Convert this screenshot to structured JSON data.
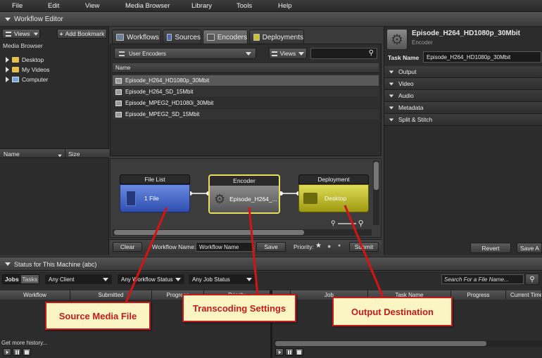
{
  "menu": [
    "File",
    "Edit",
    "View",
    "Media Browser",
    "Library",
    "Tools",
    "Help"
  ],
  "window_title": "Workflow Editor",
  "left": {
    "views_label": "Views",
    "add_bookmark_label": "Add Bookmark",
    "section_title": "Media Browser",
    "tree": [
      "Desktop",
      "My Videos",
      "Computer"
    ],
    "col_name": "Name",
    "col_size": "Size"
  },
  "tabs": [
    "Workflows",
    "Sources",
    "Encoders",
    "Deployments"
  ],
  "encoders": {
    "group_select": "User Encoders",
    "views_label": "Views",
    "search_value": "",
    "col_name": "Name",
    "items": [
      "Episode_H264_HD1080p_30Mbit",
      "Episode_H264_SD_15Mbit",
      "Episode_MPEG2_HD1080i_30Mbit",
      "Episode_MPEG2_SD_15Mbit"
    ]
  },
  "workflow": {
    "nodes": [
      {
        "title": "File List",
        "label": "1 File"
      },
      {
        "title": "Encoder",
        "label": "Episode_H264_..."
      },
      {
        "title": "Deployment",
        "label": "Desktop"
      }
    ],
    "clear_label": "Clear",
    "name_label": "Workflow Name:",
    "name_value": "Workflow Name",
    "save_label": "Save",
    "priority_label": "Priority:",
    "submit_label": "Submit"
  },
  "inspector": {
    "title": "Episode_H264_HD1080p_30Mbit",
    "subtitle": "Encoder",
    "task_name_label": "Task Name",
    "task_name_value": "Episode_H264_HD1080p_30Mbit",
    "sections": [
      "Output",
      "Video",
      "Audio",
      "Metadata",
      "Split & Stitch"
    ],
    "revert_label": "Revert",
    "save_as_label": "Save A"
  },
  "status": {
    "title": "Status for This Machine (abc)",
    "jobs_label": "Jobs",
    "tasks_label": "Tasks",
    "filter_client": "Any Client",
    "filter_workflow": "Any Workflow Status",
    "filter_job": "Any Job Status",
    "search_placeholder": "Search For a File Name...",
    "left_cols": [
      "Workflow",
      "Submitted",
      "Progress",
      "Priority"
    ],
    "right_cols": [
      "Job",
      "Task Name",
      "Progress",
      "Current Time"
    ],
    "more_history": "Get more history..."
  },
  "callouts": [
    "Source Media File",
    "Transcoding Settings",
    "Output Destination"
  ],
  "colors": {
    "callout_border": "#c81a1a",
    "callout_bg": "#fbf5c4",
    "file_node": "#3a5fc0",
    "deploy_node": "#b5b320",
    "encoder_highlight": "#e8e05a"
  },
  "icons": [
    "list-icon",
    "plus-icon",
    "folder-icon",
    "computer-icon",
    "workflows-icon",
    "sources-icon",
    "encoders-icon",
    "deployments-icon",
    "search-icon",
    "gear-icon",
    "file-icon",
    "zoom-icon",
    "play-icon",
    "pause-icon",
    "stop-icon"
  ]
}
